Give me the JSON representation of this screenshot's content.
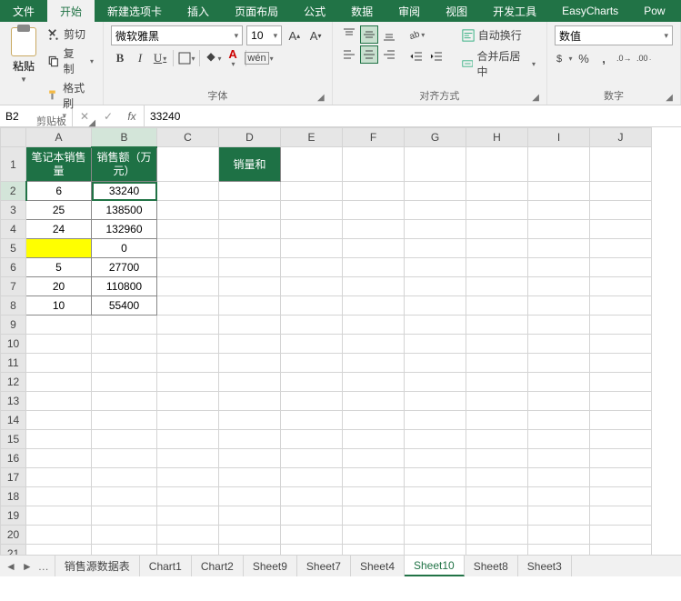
{
  "ribbon_tabs": [
    "文件",
    "开始",
    "新建选项卡",
    "插入",
    "页面布局",
    "公式",
    "数据",
    "审阅",
    "视图",
    "开发工具",
    "EasyCharts",
    "Pow"
  ],
  "active_ribbon_tab": 1,
  "clipboard": {
    "paste": "粘贴",
    "cut": "剪切",
    "copy": "复制",
    "format_painter": "格式刷",
    "group_label": "剪贴板"
  },
  "font": {
    "name": "微软雅黑",
    "size": "10",
    "group_label": "字体"
  },
  "align": {
    "wrap": "自动换行",
    "merge": "合并后居中",
    "group_label": "对齐方式"
  },
  "number": {
    "format": "数值",
    "group_label": "数字"
  },
  "name_box": "B2",
  "formula_value": "33240",
  "columns": [
    "A",
    "B",
    "C",
    "D",
    "E",
    "F",
    "G",
    "H",
    "I",
    "J"
  ],
  "row_count": 21,
  "headers": {
    "A": "笔记本销售量",
    "B": "销售额（万元）",
    "D": "销量和"
  },
  "table_rows": [
    {
      "a": "6",
      "b": "33240"
    },
    {
      "a": "25",
      "b": "138500"
    },
    {
      "a": "24",
      "b": "132960"
    },
    {
      "a": "",
      "b": "0",
      "yellow": true
    },
    {
      "a": "5",
      "b": "27700"
    },
    {
      "a": "20",
      "b": "110800"
    },
    {
      "a": "10",
      "b": "55400"
    }
  ],
  "selected": {
    "col": "B",
    "row": 2
  },
  "sheet_tabs": [
    "销售源数据表",
    "Chart1",
    "Chart2",
    "Sheet9",
    "Sheet7",
    "Sheet4",
    "Sheet10",
    "Sheet8",
    "Sheet3"
  ],
  "active_sheet_tab": 6,
  "chart_data": {
    "type": "table",
    "title": "笔记本销售量 / 销售额（万元）",
    "columns": [
      "笔记本销售量",
      "销售额（万元）"
    ],
    "rows": [
      [
        6,
        33240
      ],
      [
        25,
        138500
      ],
      [
        24,
        132960
      ],
      [
        null,
        0
      ],
      [
        5,
        27700
      ],
      [
        20,
        110800
      ],
      [
        10,
        55400
      ]
    ]
  }
}
